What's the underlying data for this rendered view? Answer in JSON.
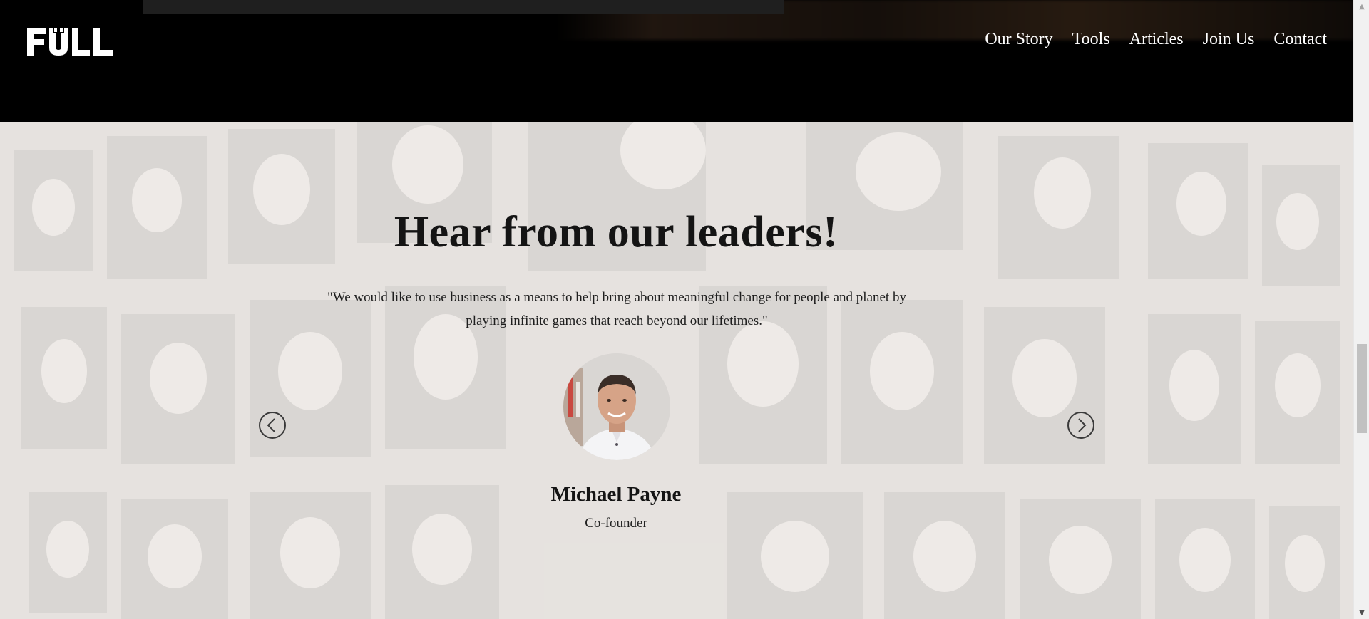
{
  "brand": {
    "logo_text": "FULL"
  },
  "nav": {
    "items": [
      {
        "label": "Our Story"
      },
      {
        "label": "Tools"
      },
      {
        "label": "Articles"
      },
      {
        "label": "Join Us"
      },
      {
        "label": "Contact"
      }
    ]
  },
  "leaders": {
    "heading": "Hear from our leaders!",
    "quote": "\"We would like to use business as a means to help bring about meaningful change for people and planet by playing infinite games that reach beyond our lifetimes.\"",
    "person": {
      "name": "Michael Payne",
      "role": "Co-founder"
    },
    "prev_icon": "chevron-left-circle-icon",
    "next_icon": "chevron-right-circle-icon"
  },
  "colors": {
    "header_bg": "#000000",
    "section_bg": "#f3f1ee",
    "text": "#141414"
  }
}
